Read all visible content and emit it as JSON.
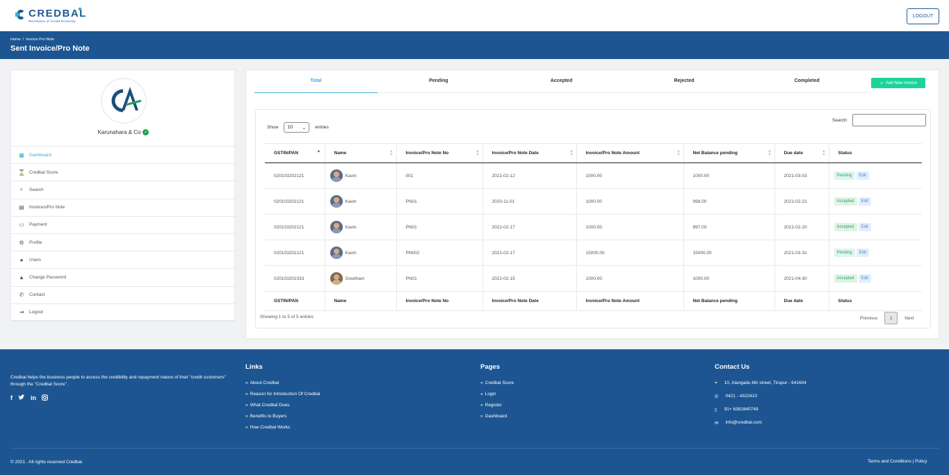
{
  "brand": {
    "name": "CREDBAL",
    "tagline": "Revolution of Credit Economy"
  },
  "header": {
    "logout_label": "LOGOUT"
  },
  "breadcrumb": {
    "home": "Home",
    "sep": "/",
    "current": "Invoice Pro Note"
  },
  "page_title": "Sent Invoice/Pro Note",
  "profile": {
    "initials": "CA",
    "company": "Karunahara & Co"
  },
  "sidebar": {
    "items": [
      {
        "label": "Dashboard",
        "icon": "dashboard-icon"
      },
      {
        "label": "Credbal Score",
        "icon": "hourglass-icon"
      },
      {
        "label": "Search",
        "icon": "search-icon"
      },
      {
        "label": "Invoices/Pro Note",
        "icon": "document-icon"
      },
      {
        "label": "Payment",
        "icon": "credit-card-icon"
      },
      {
        "label": "Profile",
        "icon": "user-gear-icon"
      },
      {
        "label": "Users",
        "icon": "user-icon"
      },
      {
        "label": "Change Password",
        "icon": "lock-icon"
      },
      {
        "label": "Contact",
        "icon": "phone-icon"
      },
      {
        "label": "Logout",
        "icon": "sign-out-icon"
      }
    ],
    "active": "Dashboard"
  },
  "tabs": [
    "Total",
    "Pending",
    "Accepted",
    "Rejected",
    "Completed"
  ],
  "active_tab": "Total",
  "add_button": "Add New Invoice",
  "table": {
    "show_label": "Show",
    "entries_value": "10",
    "entries_label": "entries",
    "search_label": "Search:",
    "columns": [
      "GSTIN/PAN",
      "Name",
      "Invoice/Pro Note No",
      "Invoice/Pro Note Date",
      "Invoice/Pro Note Amount",
      "Net Balance pending",
      "Due date",
      "Status"
    ],
    "rows": [
      {
        "gstin": "020103202121",
        "name": "Kavin",
        "no": "001",
        "date": "2021-02-12",
        "amount": "1000.00",
        "balance": "1000.00",
        "due": "2021-03-03",
        "status": "Pending",
        "edit": "Edit"
      },
      {
        "gstin": "020103202121",
        "name": "Kavin",
        "no": "PN01",
        "date": "2020-11-01",
        "amount": "1000.00",
        "balance": "998.00",
        "due": "2021-02-21",
        "status": "Accepted",
        "edit": "Edit"
      },
      {
        "gstin": "020103202121",
        "name": "Kavin",
        "no": "PN01",
        "date": "2021-02-17",
        "amount": "1000.00",
        "balance": "997.00",
        "due": "2021-02-20",
        "status": "Accepted",
        "edit": "Edit"
      },
      {
        "gstin": "020103202121",
        "name": "Kavin",
        "no": "PN002",
        "date": "2021-02-17",
        "amount": "15000.00",
        "balance": "15000.00",
        "due": "2021-03-31",
        "status": "Pending",
        "edit": "Edit"
      },
      {
        "gstin": "020103202333",
        "name": "Gowtham",
        "no": "PN01",
        "date": "2021-02-15",
        "amount": "1000.00",
        "balance": "1000.00",
        "due": "2021-04-30",
        "status": "Accepted",
        "edit": "Edit"
      }
    ],
    "info": "Showing 1 to 5 of 5 entries",
    "previous": "Previous",
    "page": "1",
    "next": "Next"
  },
  "footer": {
    "about": "Credbal helps the business people to access the credibility and repayment nature of their \"credit customers\" through the \"Credbal Score\".",
    "links_title": "Links",
    "links": [
      "About Credbal",
      "Reason for Introduction Of Credbal",
      "What Credbal Does",
      "Benefits to Buyers",
      "How Credbal Works"
    ],
    "pages_title": "Pages",
    "pages": [
      "Credbal Score",
      "Login",
      "Register",
      "Dashboard"
    ],
    "contact_title": "Contact Us",
    "address": "10, Alangadu 6th street, Tirupur - 641604",
    "phone": "0421 - 4322410",
    "mobile": "91+ 6381840749",
    "email": "info@credbal.com",
    "copyright": "© 2021 . All rights reserved Credbal.",
    "terms": "Terms and Conditions | Policy"
  },
  "colors": {
    "primary": "#1c5592",
    "accent": "#3fa9dd",
    "add_button": "#1dd39a"
  }
}
